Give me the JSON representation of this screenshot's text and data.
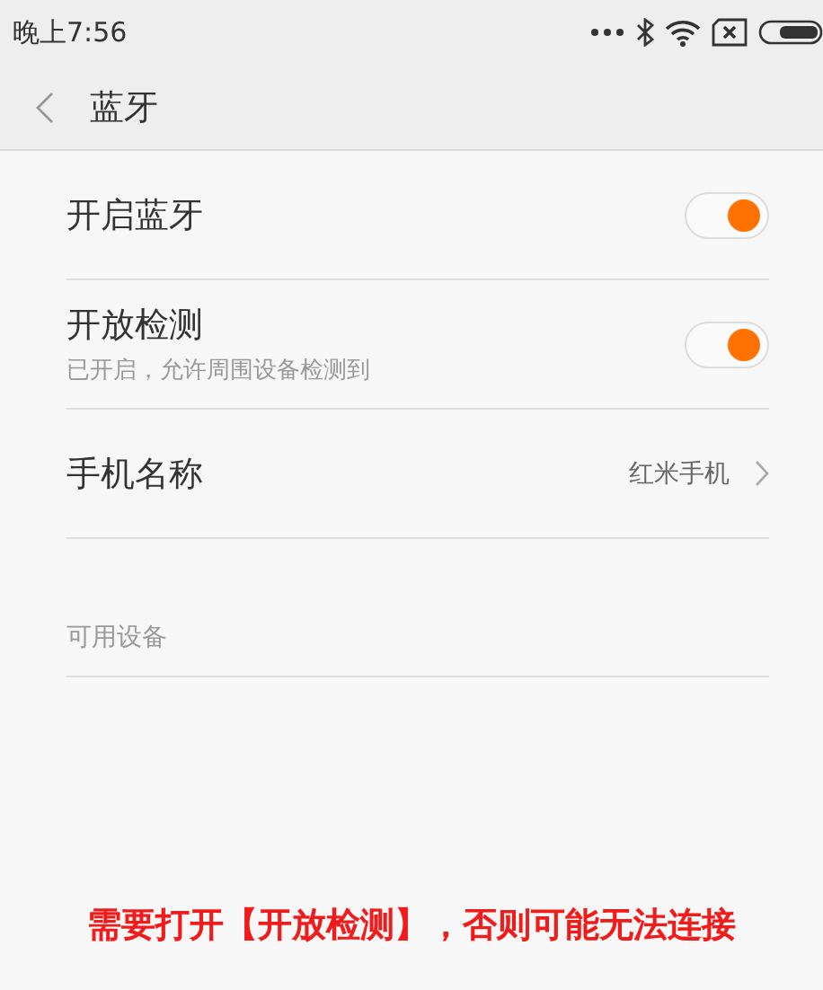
{
  "status_bar": {
    "time": "晚上7:56"
  },
  "header": {
    "title": "蓝牙"
  },
  "settings": [
    {
      "kind": "toggle",
      "label": "开启蓝牙",
      "on": true
    },
    {
      "kind": "toggle",
      "label": "开放检测",
      "subtitle": "已开启，允许周围设备检测到",
      "on": true
    },
    {
      "kind": "link",
      "label": "手机名称",
      "value": "红米手机"
    }
  ],
  "section": {
    "title": "可用设备"
  },
  "notice": "需要打开【开放检测】，否则可能无法连接"
}
